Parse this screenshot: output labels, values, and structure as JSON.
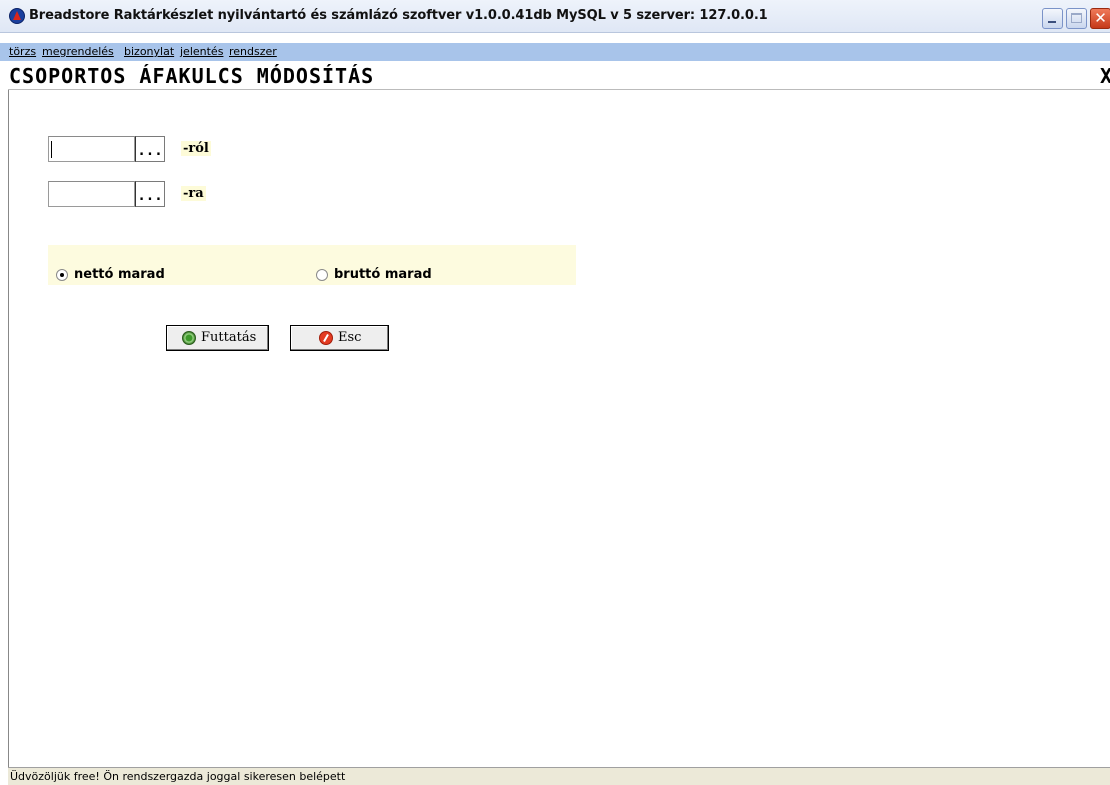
{
  "window": {
    "title": "Breadstore Raktárkészlet nyilvántartó és számlázó szoftver v1.0.0.41db MySQL v 5   szerver: 127.0.0.1",
    "controls": {
      "minimize": "minimize-icon",
      "maximize": "maximize-icon",
      "close": "✕"
    }
  },
  "menu": {
    "items": [
      {
        "label": "törzs"
      },
      {
        "label": "megrendelés"
      },
      {
        "label": "bizonylat"
      },
      {
        "label": "jelentés"
      },
      {
        "label": "rendszer"
      }
    ]
  },
  "page": {
    "title": "CSOPORTOS ÁFAKULCS MÓDOSÍTÁS",
    "close_glyph": "X"
  },
  "form": {
    "from": {
      "value": "",
      "browse_label": "...",
      "suffix": "-ról"
    },
    "to": {
      "value": "",
      "browse_label": "...",
      "suffix": "-ra"
    },
    "options": [
      {
        "label": "nettó marad",
        "checked": true
      },
      {
        "label": "bruttó marad",
        "checked": false
      }
    ]
  },
  "buttons": {
    "run": {
      "label": "Futtatás",
      "icon": "run-icon"
    },
    "esc": {
      "label": "Esc",
      "icon": "stop-icon"
    }
  },
  "status": {
    "text": "Üdvözöljük free! Ön rendszergazda joggal sikeresen belépett"
  }
}
